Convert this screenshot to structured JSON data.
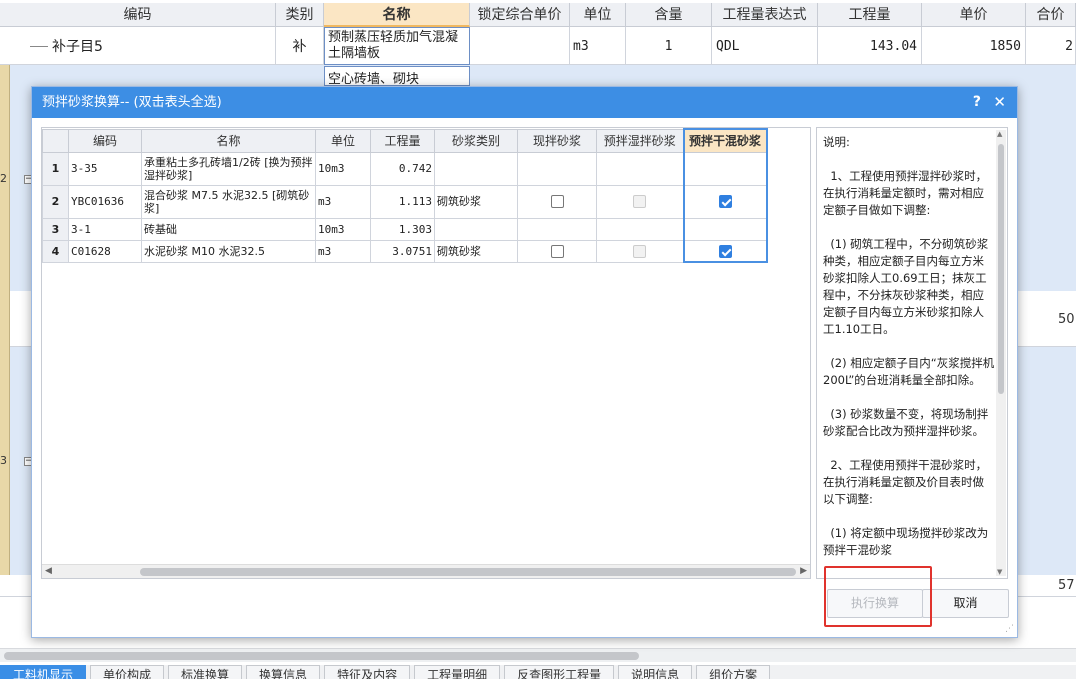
{
  "background": {
    "headers": [
      "编码",
      "类别",
      "名称",
      "锁定综合单价",
      "单位",
      "含量",
      "工程量表达式",
      "工程量",
      "单价",
      "合价"
    ],
    "row1": {
      "code": "补子目5",
      "type": "补",
      "name": "预制蒸压轻质加气混凝土隔墙板",
      "unit": "m3",
      "content": "1",
      "expr": "QDL",
      "qty": "143.04",
      "price": "1850",
      "total": "2"
    },
    "row2_name": "空心砖墙、砌块",
    "left_marks": [
      "2",
      "3"
    ],
    "right_values": [
      "50",
      "57"
    ],
    "bottom_tabs": [
      "工料机显示",
      "单价构成",
      "标准换算",
      "换算信息",
      "特征及内容",
      "工程量明细",
      "反查图形工程量",
      "说明信息",
      "组价方案"
    ]
  },
  "dialog": {
    "title": "预拌砂浆换算-- (双击表头全选)",
    "help_label": "?",
    "close_label": "✕",
    "columns": [
      "编码",
      "名称",
      "单位",
      "工程量",
      "砂浆类别",
      "现拌砂浆",
      "预拌湿拌砂浆",
      "预拌干混砂浆"
    ],
    "rows": [
      {
        "no": "1",
        "code": "3-35",
        "name": "承重粘土多孔砖墙1/2砖 [换为预拌湿拌砂浆]",
        "unit": "10m3",
        "qty": "0.742",
        "category": "",
        "site": null,
        "wet": null,
        "dry": null
      },
      {
        "no": "2",
        "code": "YBC01636",
        "name": "混合砂浆 M7.5 水泥32.5 [砌筑砂浆]",
        "unit": "m3",
        "qty": "1.113",
        "category": "砌筑砂浆",
        "site": false,
        "wet": false,
        "dry": true
      },
      {
        "no": "3",
        "code": "3-1",
        "name": "砖基础",
        "unit": "10m3",
        "qty": "1.303",
        "category": "",
        "site": null,
        "wet": null,
        "dry": null
      },
      {
        "no": "4",
        "code": "C01628",
        "name": "水泥砂浆 M10 水泥32.5",
        "unit": "m3",
        "qty": "3.0751",
        "category": "砌筑砂浆",
        "site": false,
        "wet": false,
        "dry": true
      }
    ],
    "description": "说明:\n\n  1、工程使用预拌湿拌砂浆时，在执行消耗量定额时，需对相应定额子目做如下调整:\n\n  (1) 砌筑工程中，不分砌筑砂浆种类，相应定额子目内每立方米砂浆扣除人工0.69工日；抹灰工程中，不分抹灰砂浆种类，相应定额子目内每立方米砂浆扣除人工1.10工日。\n\n  (2) 相应定额子目内“灰浆搅拌机200L”的台班消耗量全部扣除。\n\n  (3) 砂浆数量不变，将现场制拌砂浆配合比改为预拌湿拌砂浆。\n\n  2、工程使用预拌干混砂浆时，在执行消耗量定额及价目表时做以下调整:\n\n  (1) 将定额中现场搅拌砂浆改为预拌干混砂浆",
    "execute_label": "执行换算",
    "cancel_label": "取消"
  }
}
